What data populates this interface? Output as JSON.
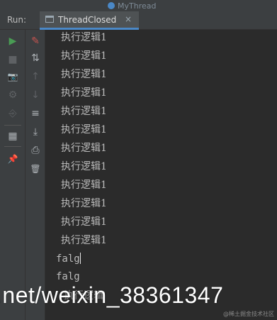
{
  "window": {
    "crumb_title": "MyThread"
  },
  "tabbar": {
    "run_label": "Run:",
    "tab_title": "ThreadClosed",
    "close_glyph": "×"
  },
  "toolbar_left": [
    {
      "name": "rerun-icon",
      "glyph": "▶",
      "color": "#499c54"
    },
    {
      "name": "stop-icon",
      "glyph": "■",
      "color": "#5e6164"
    },
    {
      "name": "camera-icon",
      "glyph": "📷",
      "color": "#5e6164"
    },
    {
      "name": "settings-icon",
      "glyph": "⚙",
      "color": "#5e6164"
    },
    {
      "name": "exit-icon",
      "glyph": "⎆",
      "color": "#5e6164"
    },
    {
      "name": "layout-icon",
      "glyph": "▦",
      "color": "#aeb3b7"
    },
    {
      "name": "pin-icon",
      "glyph": "📌",
      "color": "#aeb3b7"
    }
  ],
  "toolbar_right": [
    {
      "name": "clear-icon",
      "glyph": "✎",
      "color": "#c75450"
    },
    {
      "name": "sort-icon",
      "glyph": "⇅",
      "color": "#aeb3b7"
    },
    {
      "name": "up-arrow-icon",
      "glyph": "↑",
      "color": "#5e6164"
    },
    {
      "name": "down-arrow-icon",
      "glyph": "↓",
      "color": "#5e6164"
    },
    {
      "name": "soft-wrap-icon",
      "glyph": "≡",
      "color": "#aeb3b7"
    },
    {
      "name": "scroll-end-icon",
      "glyph": "⤓",
      "color": "#aeb3b7"
    },
    {
      "name": "print-icon",
      "glyph": "⎙",
      "color": "#aeb3b7"
    },
    {
      "name": "trash-icon",
      "glyph": "🗑",
      "color": "#aeb3b7"
    }
  ],
  "console": {
    "lines": [
      "执行逻辑1",
      "执行逻辑1",
      "执行逻辑1",
      "执行逻辑1",
      "执行逻辑1",
      "执行逻辑1",
      "执行逻辑1",
      "执行逻辑1",
      "执行逻辑1",
      "执行逻辑1",
      "执行逻辑1",
      "执行逻辑1"
    ],
    "falg_line_1": "falg",
    "falg_line_2": "falg",
    "partial_line": "执行逻辑"
  },
  "overlay": {
    "watermark": ".net/weixin_38361347",
    "badge": "@稀土掘金技术社区"
  }
}
